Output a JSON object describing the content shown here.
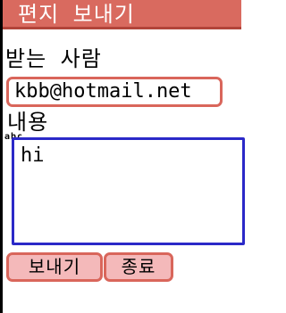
{
  "header": {
    "title": "편지 보내기"
  },
  "form": {
    "recipient_label": "받는 사람",
    "recipient_value": "kbb@hotmail.net",
    "content_label": "내용",
    "input_mode_indicator": "abc",
    "message_value": "hi"
  },
  "softkeys": {
    "send_label": "보내기",
    "exit_label": "종료"
  },
  "colors": {
    "title_bar": "#d96a5f",
    "field_border": "#d9665b",
    "message_border": "#2b29c8",
    "button_fill": "#f4b9ba"
  }
}
